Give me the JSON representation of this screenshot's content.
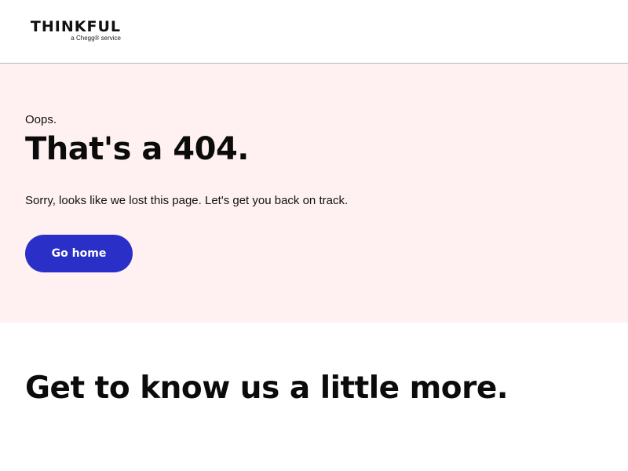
{
  "header": {
    "logo_text": "THINKFUL",
    "logo_tagline": "a Chegg® service"
  },
  "hero": {
    "eyebrow": "Oops.",
    "headline": "That's a 404.",
    "message": "Sorry, looks like we lost this page. Let's get you back on track.",
    "button_label": "Go home",
    "background_color": "#fff1f1",
    "button_color": "#2a2fc8"
  },
  "section": {
    "title": "Get to know us a little more."
  }
}
